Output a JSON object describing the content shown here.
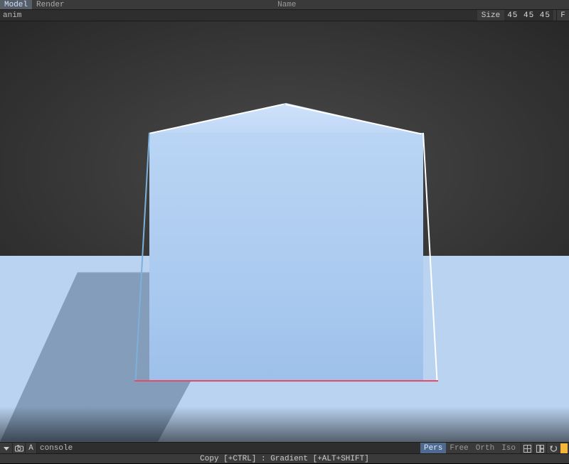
{
  "tabs": {
    "model": "Model",
    "render": "Render"
  },
  "header": {
    "name_label": "Name"
  },
  "toolbar": {
    "anim": "anim",
    "size_label": "Size",
    "size_values": "45 45 45",
    "f_button": "F"
  },
  "viewport": {
    "object": "cube",
    "ground_color": "#b9d3f0",
    "cube_color": "#a9c9ef",
    "highlight_edge_color": "#e84a66"
  },
  "bottombar": {
    "a_button": "A",
    "console": "console",
    "views": {
      "pers": "Pers",
      "free": "Free",
      "orth": "Orth",
      "iso": "Iso"
    }
  },
  "statusbar": {
    "hint": "Copy [+CTRL] : Gradient [+ALT+SHIFT]"
  },
  "icons": {
    "dropdown": "dropdown-icon",
    "camera": "camera-icon",
    "grid": "grid-icon",
    "split": "split-icon",
    "undo": "undo-icon",
    "swatch": "swatch-icon"
  }
}
